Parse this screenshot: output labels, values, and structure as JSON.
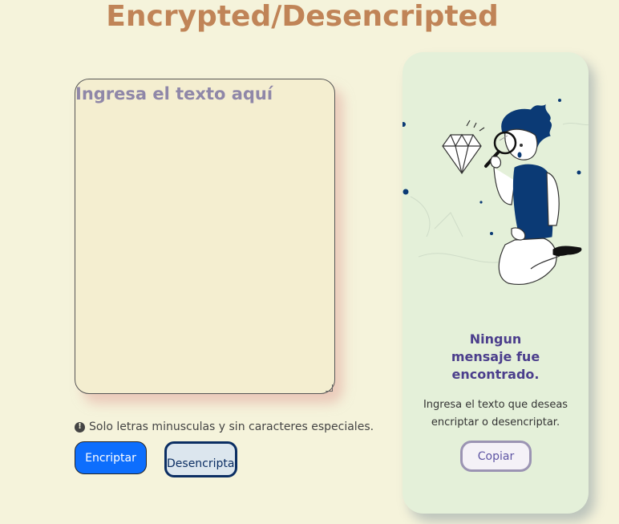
{
  "header": {
    "title": "Encrypted/Desencripted"
  },
  "input": {
    "placeholder": "Ingresa el texto aquí",
    "value": ""
  },
  "hint": {
    "icon": "exclamation-circle-icon",
    "text": "Solo letras minusculas y sin caracteres especiales."
  },
  "buttons": {
    "encrypt_label": "Encriptar",
    "decrypt_label": "Desencriptar"
  },
  "result_panel": {
    "illustration": "person-inspecting-diamond-illustration",
    "empty_title_lines": [
      "Ningun",
      "mensaje fue",
      "encontrado."
    ],
    "empty_description_lines": [
      "Ingresa el texto que deseas",
      "encriptar o desencriptar."
    ],
    "copy_label": "Copiar"
  },
  "colors": {
    "background": "#f5f3db",
    "title": "#c08457",
    "textarea_bg": "#f4eed0",
    "encrypt_button": "#0d6efd",
    "decrypt_border": "#0b2e63",
    "panel_bg": "#e4f0d9",
    "panel_title": "#4b3e8c"
  }
}
